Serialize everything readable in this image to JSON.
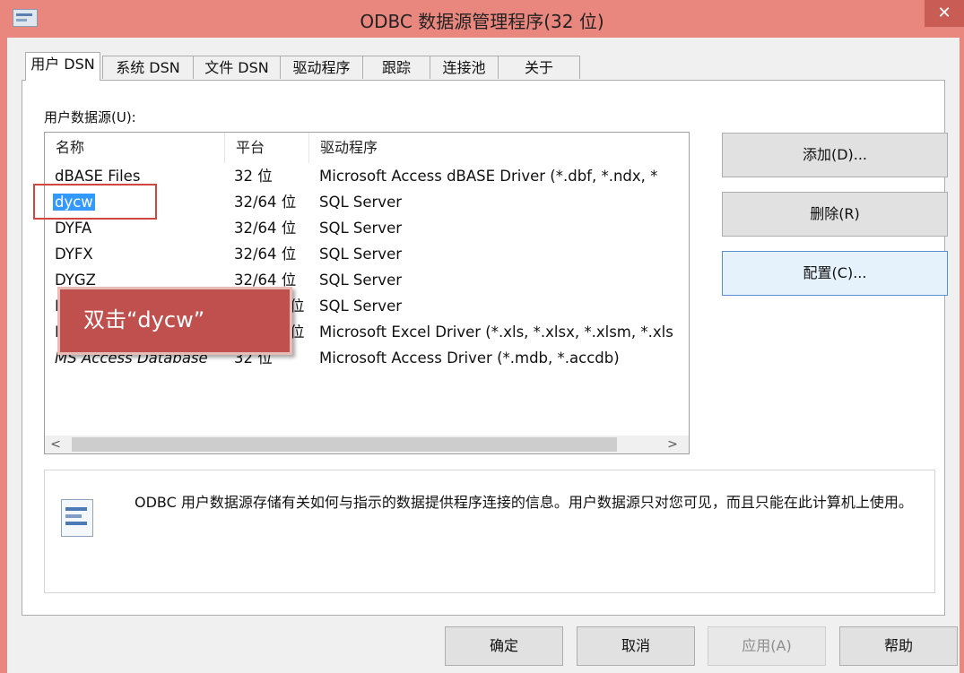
{
  "window": {
    "title": "ODBC 数据源管理程序(32 位)",
    "close_symbol": "✕"
  },
  "tabs": [
    {
      "label": "用户 DSN",
      "active": true
    },
    {
      "label": "系统 DSN"
    },
    {
      "label": "文件 DSN"
    },
    {
      "label": "驱动程序"
    },
    {
      "label": "跟踪"
    },
    {
      "label": "连接池"
    },
    {
      "label": "关于"
    }
  ],
  "panel": {
    "list_label": "用户数据源(U):",
    "columns": [
      "名称",
      "平台",
      "驱动程序"
    ],
    "rows": [
      {
        "name": "dBASE Files",
        "platform": "32 位",
        "driver": "Microsoft Access dBASE Driver (*.dbf, *.ndx, *"
      },
      {
        "name": "dycw",
        "platform": "32/64 位",
        "driver": "SQL Server",
        "selected": true
      },
      {
        "name": "DYFA",
        "platform": "32/64 位",
        "driver": "SQL Server"
      },
      {
        "name": "DYFX",
        "platform": "32/64 位",
        "driver": "SQL Server"
      },
      {
        "name": "DYGZ",
        "platform": "32/64 位",
        "driver": "SQL Server"
      },
      {
        "name": "D",
        "platform": "位",
        "driver": "SQL Server"
      },
      {
        "name": "E",
        "platform": "位",
        "driver": "Microsoft Excel Driver (*.xls, *.xlsx, *.xlsm, *.xls"
      },
      {
        "name": "MS Access Database",
        "platform": "32 位",
        "driver": "Microsoft Access Driver (*.mdb, *.accdb)"
      }
    ],
    "scroll_left": "<",
    "scroll_right": ">"
  },
  "side_buttons": {
    "add": "添加(D)...",
    "remove": "删除(R)",
    "configure": "配置(C)..."
  },
  "info": {
    "text": "ODBC 用户数据源存储有关如何与指示的数据提供程序连接的信息。用户数据源只对您可见，而且只能在此计算机上使用。"
  },
  "bottom_buttons": {
    "ok": "确定",
    "cancel": "取消",
    "apply": "应用(A)",
    "help": "帮助"
  },
  "annotation": {
    "callout_text": "双击“dycw”"
  },
  "colors": {
    "selection": "#3399ff",
    "annotation_red": "#c0504d",
    "title_bar": "#e9877f"
  }
}
